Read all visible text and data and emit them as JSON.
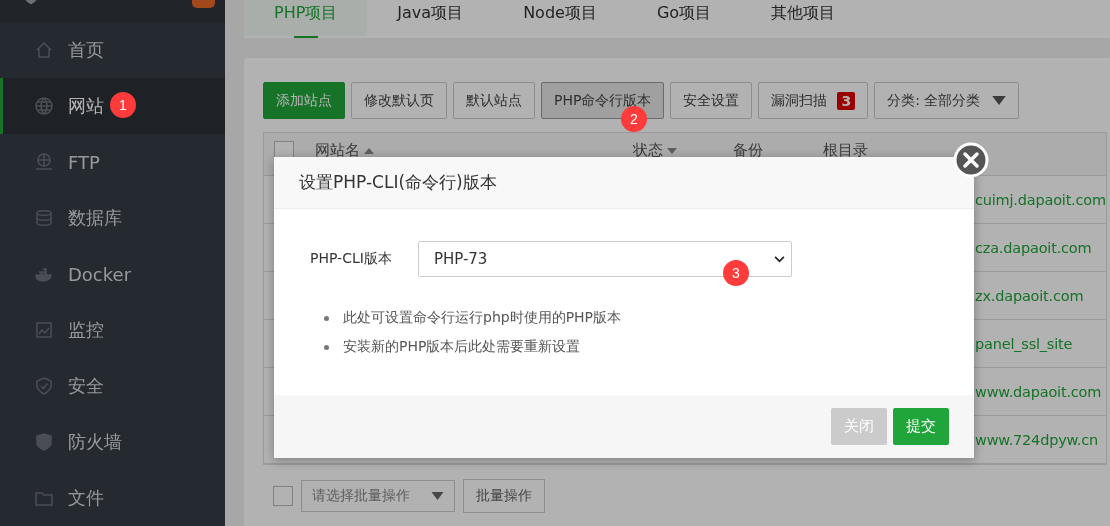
{
  "sidebar": {
    "items": [
      {
        "label": "首页",
        "selected": false
      },
      {
        "label": "网站",
        "selected": true
      },
      {
        "label": "FTP",
        "selected": false
      },
      {
        "label": "数据库",
        "selected": false
      },
      {
        "label": "Docker",
        "selected": false
      },
      {
        "label": "监控",
        "selected": false
      },
      {
        "label": "安全",
        "selected": false
      },
      {
        "label": "防火墙",
        "selected": false
      },
      {
        "label": "文件",
        "selected": false
      }
    ]
  },
  "tabs": [
    {
      "label": "PHP项目",
      "selected": true
    },
    {
      "label": "Java项目",
      "selected": false
    },
    {
      "label": "Node项目",
      "selected": false
    },
    {
      "label": "Go项目",
      "selected": false
    },
    {
      "label": "其他项目",
      "selected": false
    }
  ],
  "toolbar": [
    {
      "kind": "primary",
      "label": "添加站点",
      "selected": false
    },
    {
      "kind": "plain",
      "label": "修改默认页",
      "selected": false
    },
    {
      "kind": "plain",
      "label": "默认站点",
      "selected": false
    },
    {
      "kind": "plain",
      "label": "PHP命令行版本",
      "selected": true
    },
    {
      "kind": "plain",
      "label": "安全设置",
      "selected": false
    },
    {
      "kind": "badge",
      "label": "漏洞扫描",
      "badge": "3",
      "selected": false
    },
    {
      "kind": "dropdown",
      "label": "分类: 全部分类",
      "selected": false
    }
  ],
  "table": {
    "select_all_checked": false,
    "columns": [
      "网站名",
      "状态",
      "备份",
      "根目录"
    ],
    "rows": [
      "cuimj.dapaoit.com",
      "cza.dapaoit.com",
      "zx.dapaoit.com",
      "panel_ssl_site",
      "www.dapaoit.com",
      "www.724dpyw.cn"
    ]
  },
  "batch": {
    "checked": false,
    "placeholder": "请选择批量操作",
    "button": "批量操作"
  },
  "dialog": {
    "title": "设置PHP-CLI(命令行)版本",
    "field_label": "PHP-CLI版本",
    "value": "PHP-73",
    "notes": [
      "此处可设置命令行运行php时使用的PHP版本",
      "安装新的PHP版本后此处需要重新设置"
    ],
    "buttons": [
      {
        "label": "关闭",
        "kind": "cancel"
      },
      {
        "label": "提交",
        "kind": "submit"
      }
    ]
  },
  "markers": [
    "1",
    "2",
    "3"
  ]
}
